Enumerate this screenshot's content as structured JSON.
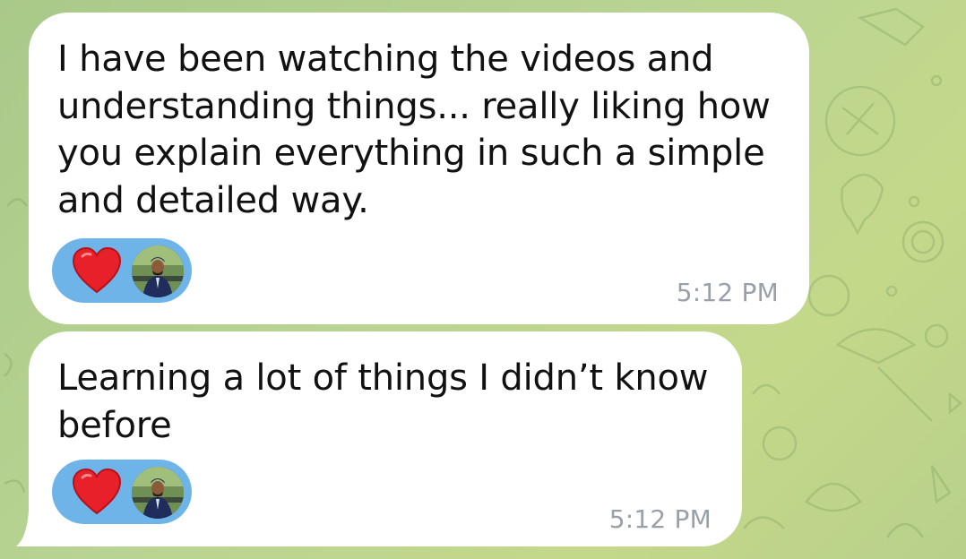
{
  "messages": [
    {
      "text": "I have been watching the videos and\nunderstanding things... really liking how\nyou explain everything in such a simple\nand detailed way.",
      "time": "5:12 PM",
      "reaction": "heart"
    },
    {
      "text": "Learning a lot of things I didn’t know\nbefore",
      "time": "5:12 PM",
      "reaction": "heart"
    }
  ],
  "colors": {
    "bubble": "#ffffff",
    "reaction_pill": "#6eb4e8",
    "heart": "#e8202a",
    "time_text": "#9aa0a8",
    "wallpaper": "#b9d492"
  },
  "icons": [
    "heart-icon",
    "reactor-avatar"
  ]
}
